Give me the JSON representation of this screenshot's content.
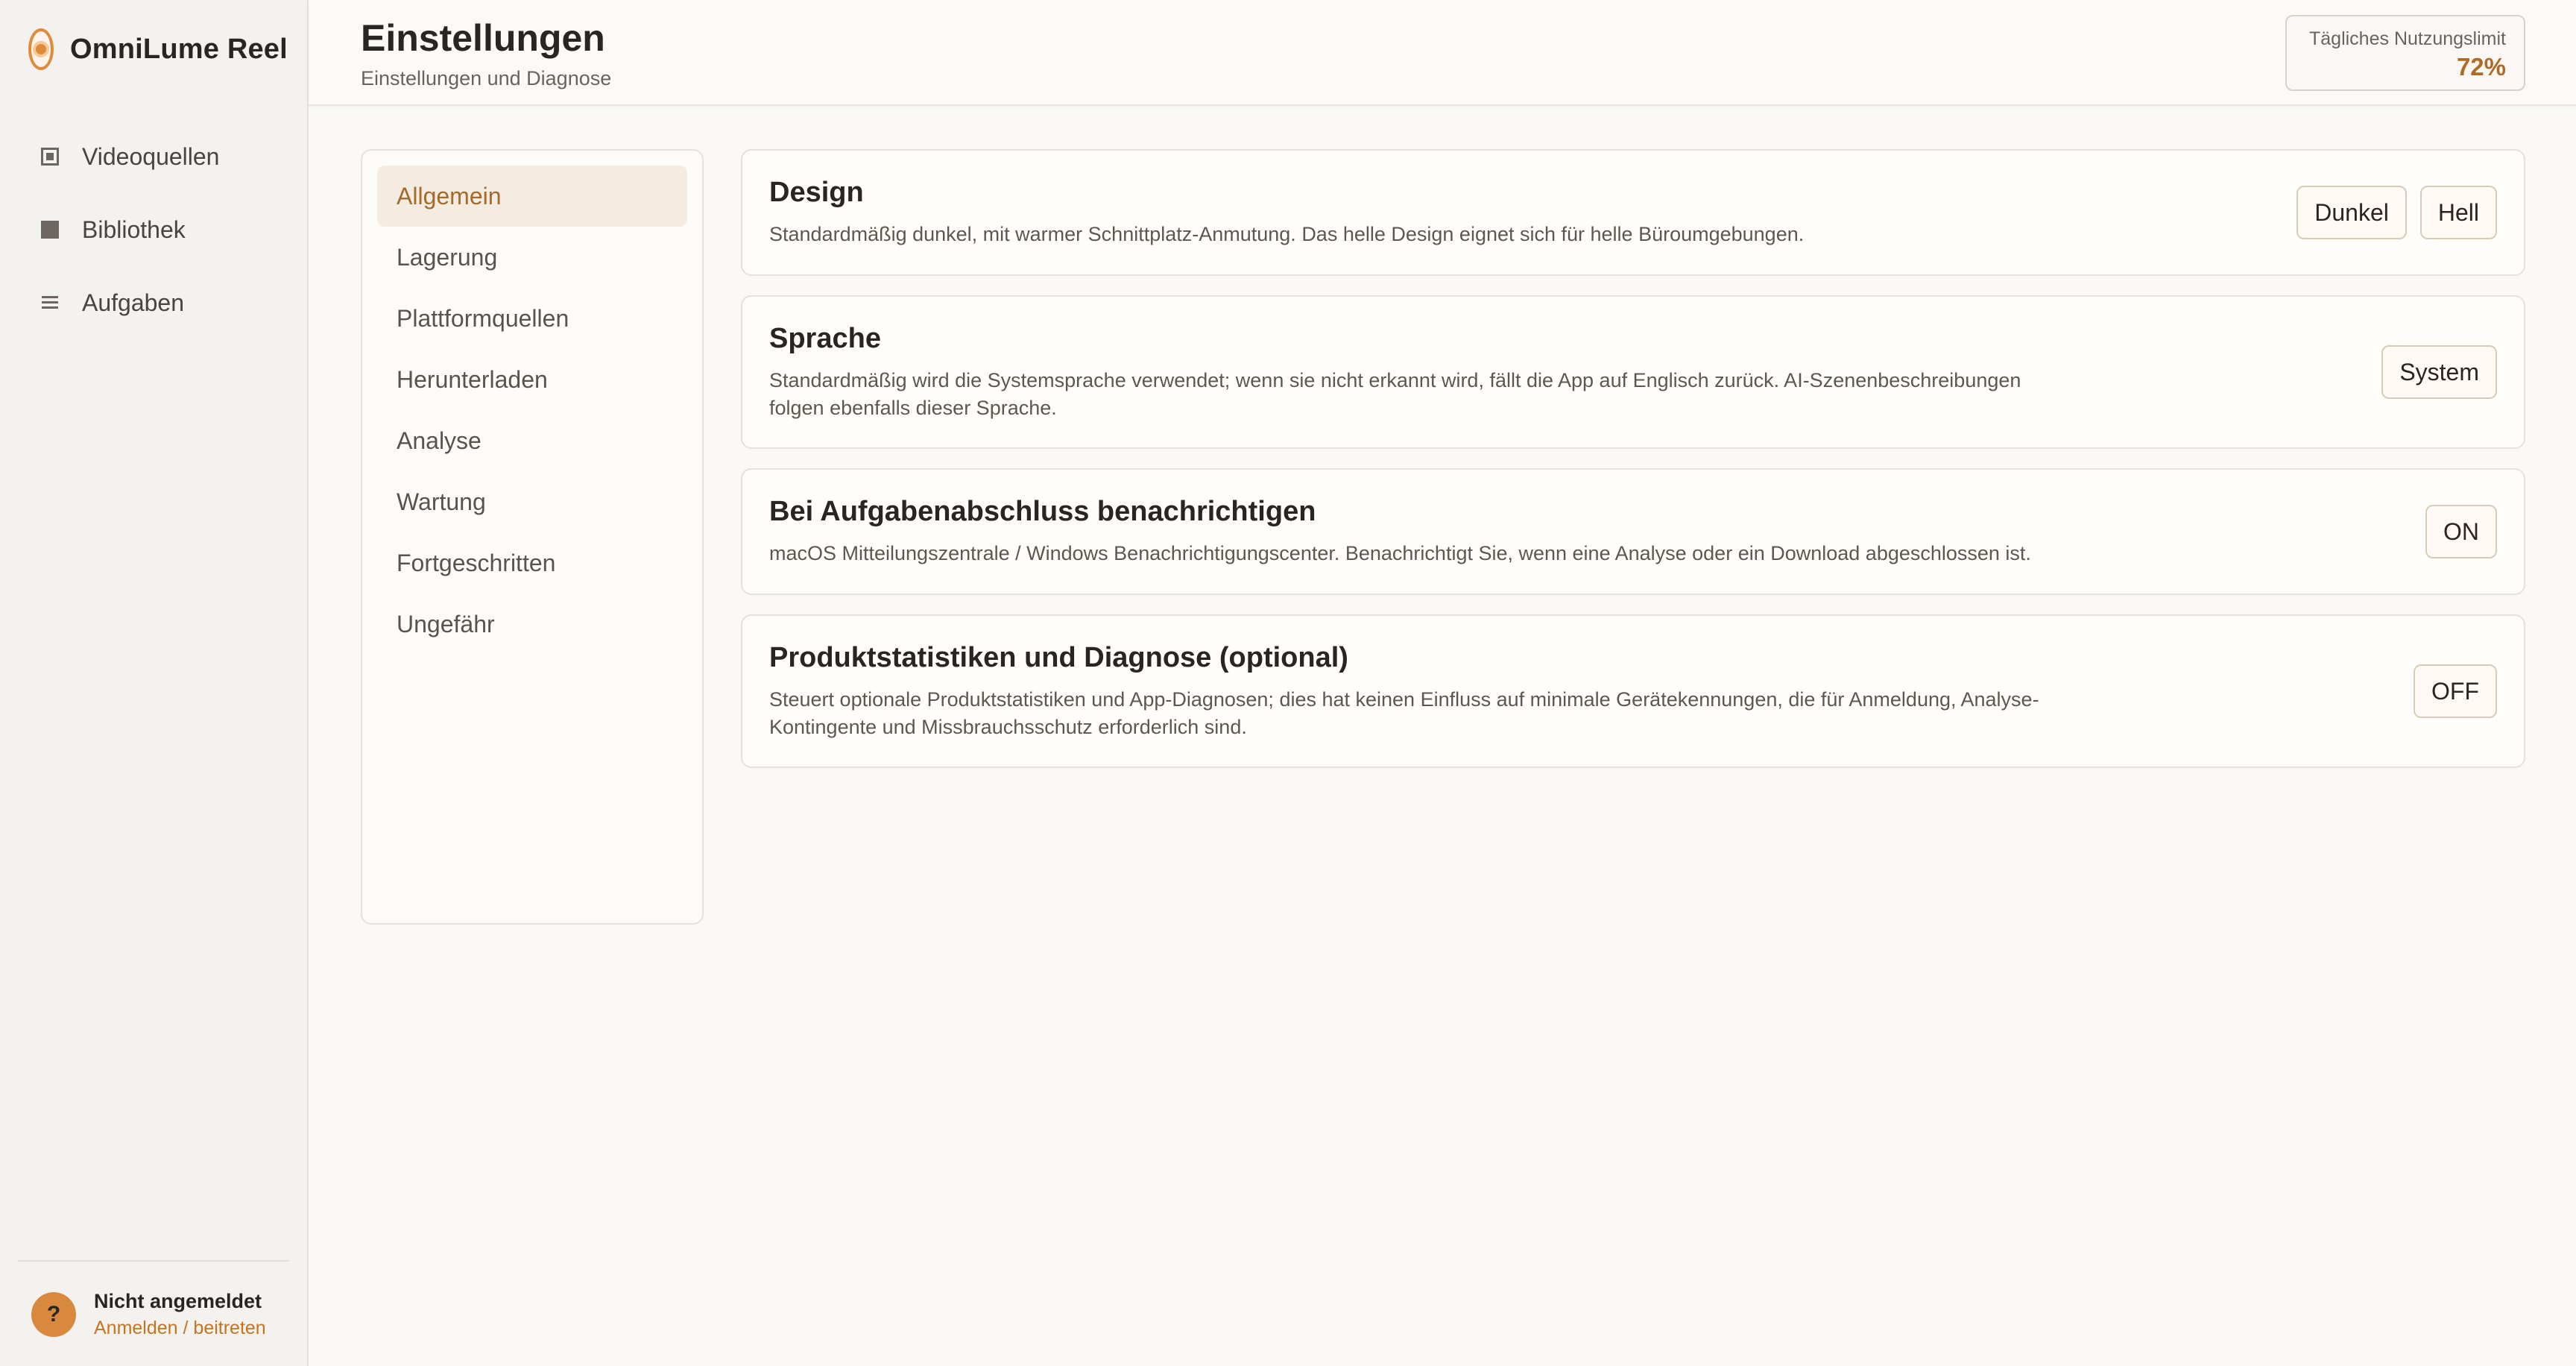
{
  "app": {
    "name": "OmniLume Reel"
  },
  "sidebar": {
    "items": [
      {
        "label": "Videoquellen",
        "icon": "video-source-icon"
      },
      {
        "label": "Bibliothek",
        "icon": "library-icon"
      },
      {
        "label": "Aufgaben",
        "icon": "tasks-icon"
      }
    ],
    "user": {
      "status": "Nicht angemeldet",
      "link": "Anmelden / beitreten",
      "avatar": "?"
    }
  },
  "header": {
    "title": "Einstellungen",
    "subtitle": "Einstellungen und Diagnose",
    "quota": {
      "label": "Tägliches Nutzungslimit",
      "value": "72%"
    }
  },
  "subnav": {
    "items": [
      {
        "label": "Allgemein",
        "active": true
      },
      {
        "label": "Lagerung"
      },
      {
        "label": "Plattformquellen"
      },
      {
        "label": "Herunterladen"
      },
      {
        "label": "Analyse"
      },
      {
        "label": "Wartung"
      },
      {
        "label": "Fortgeschritten"
      },
      {
        "label": "Ungefähr"
      }
    ]
  },
  "settings": {
    "design": {
      "title": "Design",
      "desc": "Standardmäßig dunkel, mit warmer Schnittplatz-Anmutung. Das helle Design eignet sich für helle Büroumgebungen.",
      "options": [
        "Dunkel",
        "Hell"
      ]
    },
    "language": {
      "title": "Sprache",
      "desc": "Standardmäßig wird die Systemsprache verwendet; wenn sie nicht erkannt wird, fällt die App auf Englisch zurück. AI-Szenenbeschreibungen folgen ebenfalls dieser Sprache.",
      "value": "System"
    },
    "notify": {
      "title": "Bei Aufgabenabschluss benachrichtigen",
      "desc": "macOS Mitteilungszentrale / Windows Benachrichtigungscenter. Benachrichtigt Sie, wenn eine Analyse oder ein Download abgeschlossen ist.",
      "value": "ON"
    },
    "stats": {
      "title": "Produktstatistiken und Diagnose (optional)",
      "desc": "Steuert optionale Produktstatistiken und App-Diagnosen; dies hat keinen Einfluss auf minimale Gerätekennungen, die für Anmeldung, Analyse-Kontingente und Missbrauchsschutz erforderlich sind.",
      "value": "OFF"
    }
  },
  "colors": {
    "accent": "#e08a3c",
    "active_text": "#a56a2b",
    "quota_value": "#b06a26",
    "link": "#c7741f"
  }
}
